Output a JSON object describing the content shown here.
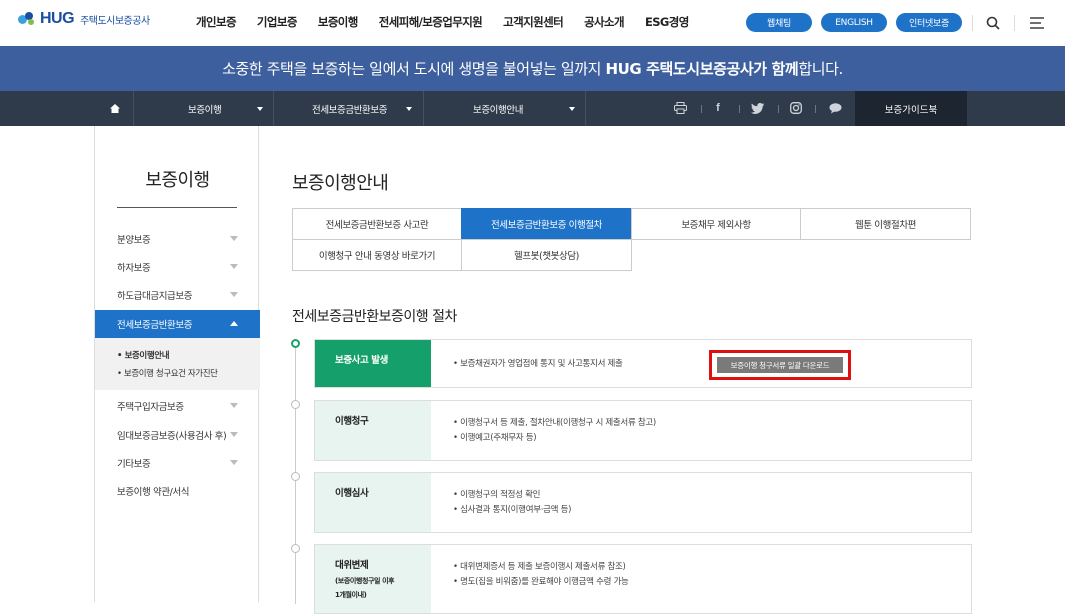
{
  "header": {
    "logo_main": "HUG",
    "logo_sub": "주택도시보증공사",
    "gnb": [
      "개인보증",
      "기업보증",
      "보증이행",
      "전세피해/보증업무지원",
      "고객지원센터",
      "공사소개",
      "ESG경영"
    ],
    "buttons": [
      "웹채팅",
      "ENGLISH",
      "인터넷보증"
    ],
    "colors": {
      "brand": "#1a4fa0",
      "pill": "#1e73c9"
    }
  },
  "banner": {
    "text_before": "소중한 주택을 보증하는 일에서 도시에 생명을 불어넣는 일까지 ",
    "text_bold": "HUG 주택도시보증공사가 함께",
    "text_after": "합니다.",
    "color": "#3d5f9e"
  },
  "subnav": {
    "home_icon": "home-icon",
    "crumbs": [
      "보증이행",
      "전세보증금반환보증",
      "보증이행안내"
    ],
    "guide_label": "보증가이드북",
    "share_icons": [
      "print-icon",
      "facebook-icon",
      "twitter-icon",
      "instagram-icon",
      "chat-icon"
    ]
  },
  "lnb": {
    "title": "보증이행",
    "items": [
      {
        "label": "분양보증"
      },
      {
        "label": "하자보증"
      },
      {
        "label": "하도급대금지급보증"
      },
      {
        "label": "전세보증금반환보증"
      },
      {
        "label": "주택구입자금보증"
      },
      {
        "label": "임대보증금보증(사용검사 후)"
      },
      {
        "label": "기타보증"
      },
      {
        "label": "보증이행 약관/서식"
      }
    ],
    "sub_items": [
      "• 보증이행안내",
      "• 보증이행 청구요건 자가진단"
    ]
  },
  "main": {
    "page_title": "보증이행안내",
    "tabs": [
      "전세보증금반환보증 사고란",
      "전세보증금반환보증 이행절차",
      "보증채무 제외사항",
      "웹툰 이행절차편",
      "이행청구 안내 동영상 바로가기",
      "헬프봇(챗봇상담)"
    ],
    "section_title": "전세보증금반환보증이행 절차",
    "steps": [
      {
        "label": "보증사고 발생",
        "desc": [
          "• 보증채권자가 영업점에 통지 및 사고통지서 제출"
        ],
        "button": "보증이행 청구서류 일괄 다운로드"
      },
      {
        "label": "이행청구",
        "desc": [
          "• 이행청구서 등 제출, 절차안내(이행청구 시 제출서류 참고)",
          "• 이행예고(주채무자 등)"
        ]
      },
      {
        "label": "이행심사",
        "desc": [
          "• 이행청구의 적정성 확인",
          "• 심사결과 통지(이행여부·금액 등)"
        ]
      },
      {
        "label": "대위변제",
        "sub1": "(보증이행청구일 이후",
        "sub2": "1개월이내)",
        "desc": [
          "• 대위변제증서 등 제출 보증이행시 제출서류 참조)",
          "• 명도(집을 비워줌)를 완료해야 이행금액 수령 가능"
        ]
      }
    ],
    "colors": {
      "accent": "#1e73c9",
      "step_active": "#15a06b",
      "step_bg": "#e8f4ef",
      "highlight": "#e01010"
    }
  }
}
